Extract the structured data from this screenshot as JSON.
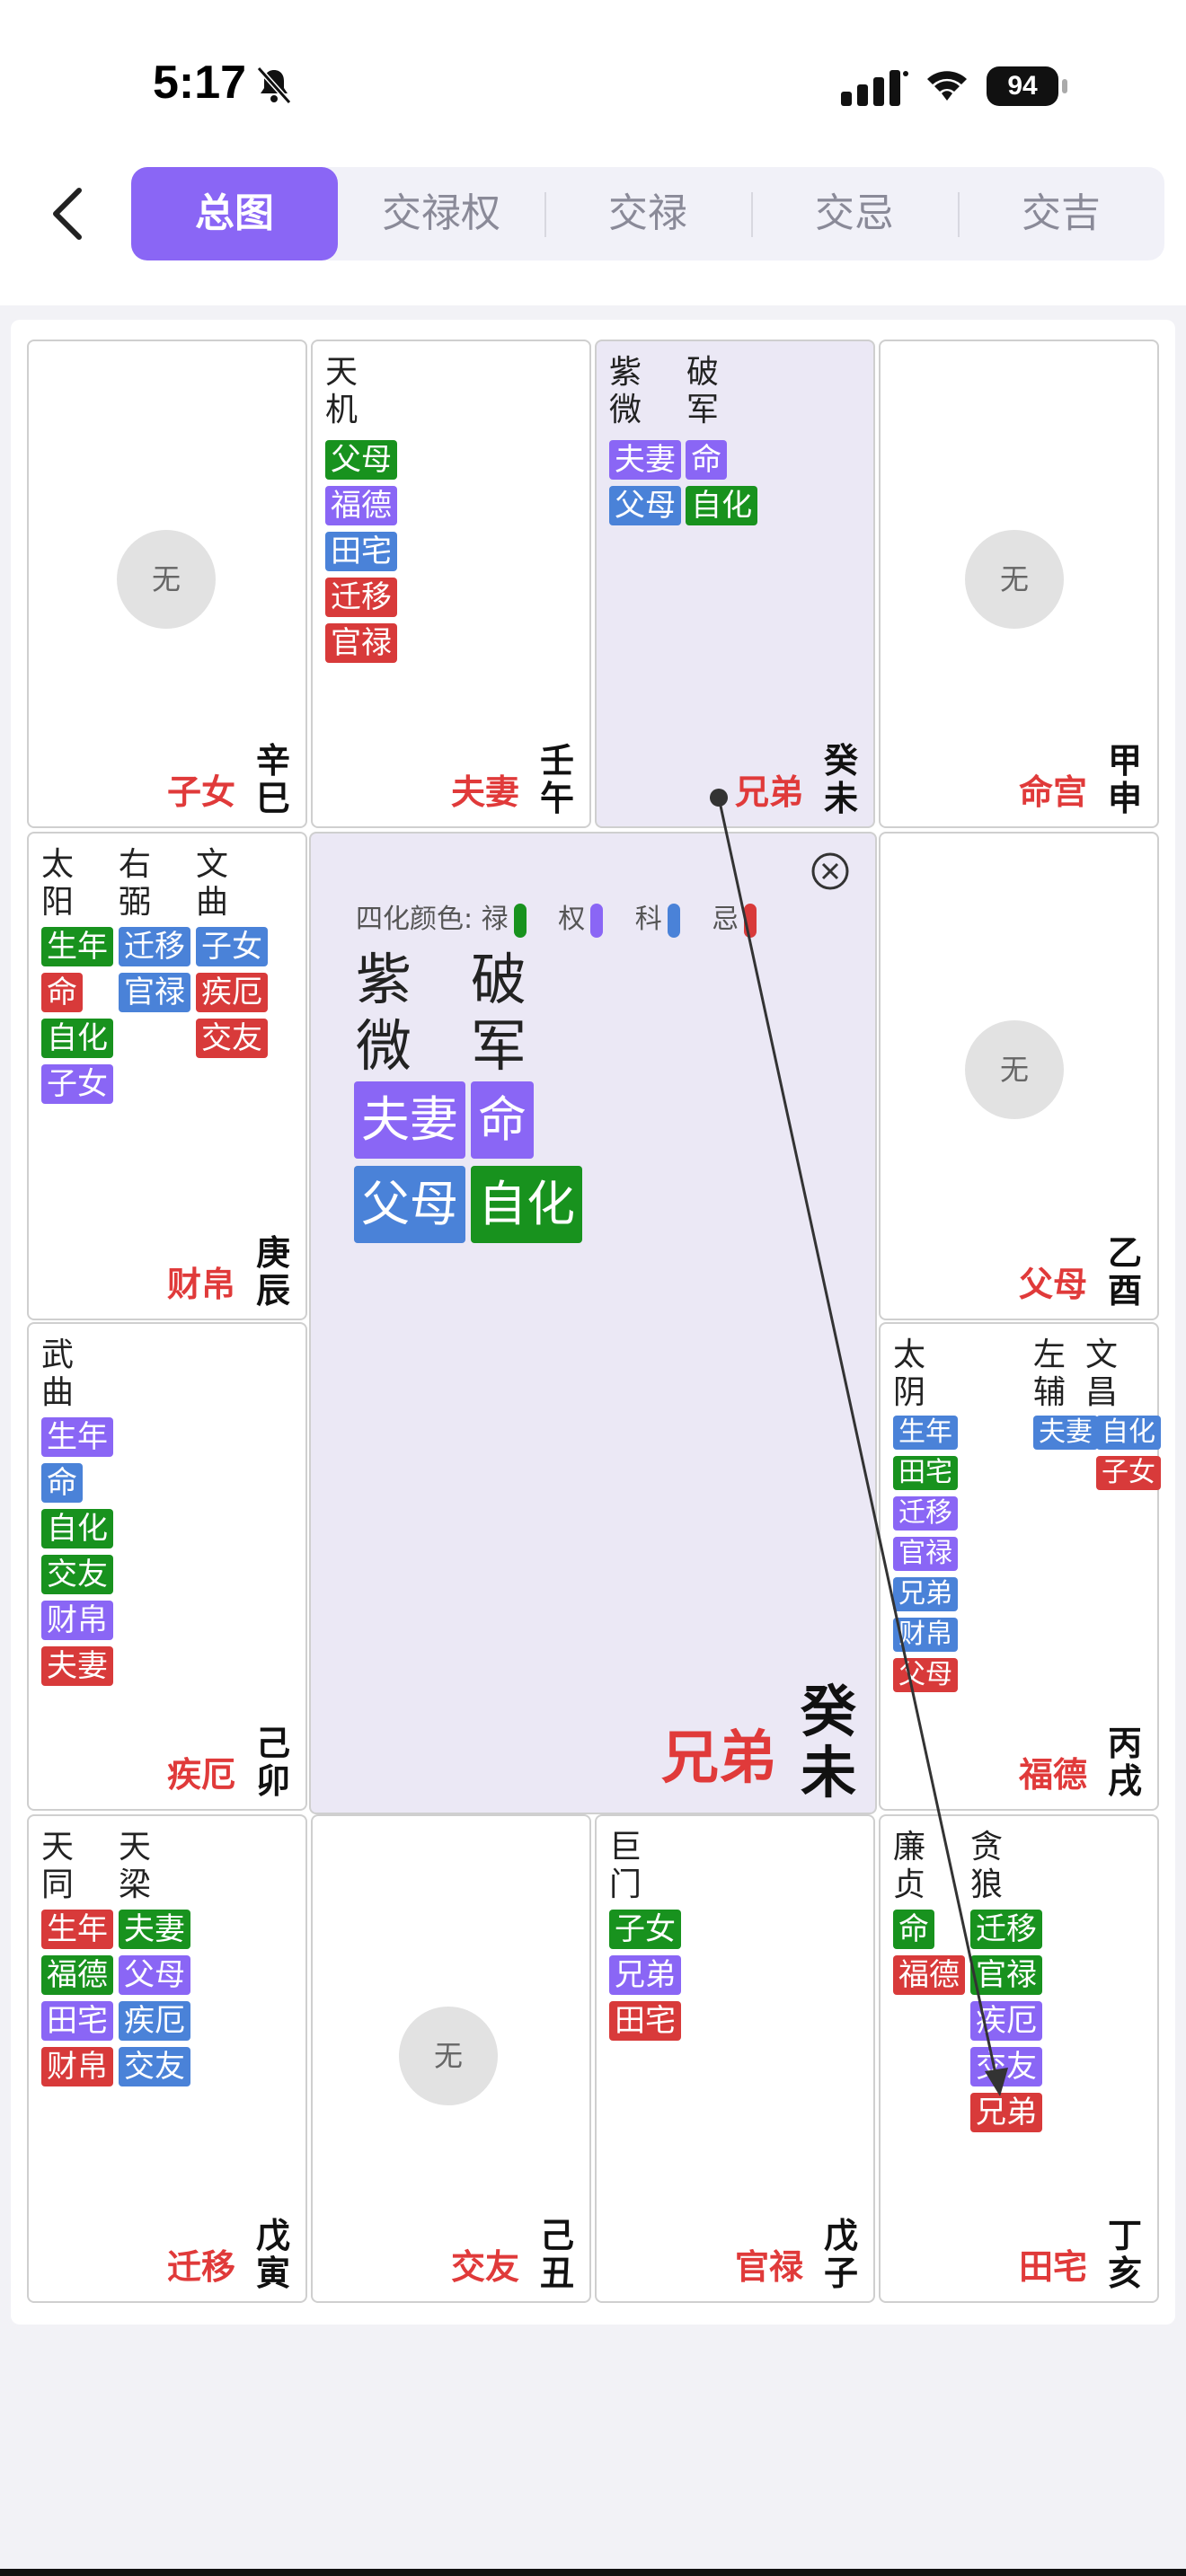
{
  "status": {
    "time": "5:17",
    "battery": "94"
  },
  "tabs": [
    "总图",
    "交禄权",
    "交禄",
    "交忌",
    "交吉"
  ],
  "legend": {
    "label": "四化颜色:",
    "items": [
      "禄",
      "权",
      "科",
      "忌"
    ]
  },
  "empty_text": "无",
  "colors": {
    "lu": "#18921e",
    "quan": "#8a66f5",
    "ke": "#4a82d8",
    "ji": "#d83a3a"
  },
  "palaces": {
    "si": {
      "name": "子女",
      "gz1": "辛",
      "gz2": "巳"
    },
    "wu": {
      "name": "夫妻",
      "gz1": "壬",
      "gz2": "午",
      "s1": [
        "天",
        "机"
      ],
      "badges": [
        "父母",
        "福德",
        "田宅",
        "迁移",
        "官禄"
      ]
    },
    "wei": {
      "name": "兄弟",
      "gz1": "癸",
      "gz2": "未",
      "s1": [
        "紫",
        "微"
      ],
      "s2": [
        "破",
        "军"
      ],
      "r1": [
        "夫妻",
        "命"
      ],
      "r2": [
        "父母",
        "自化"
      ]
    },
    "shen": {
      "name": "命宫",
      "gz1": "甲",
      "gz2": "申"
    },
    "chen": {
      "name": "财帛",
      "gz1": "庚",
      "gz2": "辰",
      "s1": [
        "太",
        "阳"
      ],
      "s2": [
        "右",
        "弼"
      ],
      "s3": [
        "文",
        "曲"
      ],
      "c1": [
        "生年",
        "命",
        "自化",
        "子女"
      ],
      "c2": [
        "迁移",
        "官禄"
      ],
      "c3": [
        "子女",
        "疾厄",
        "交友"
      ]
    },
    "you": {
      "name": "父母",
      "gz1": "乙",
      "gz2": "酉"
    },
    "mao": {
      "name": "疾厄",
      "gz1": "己",
      "gz2": "卯",
      "s1": [
        "武",
        "曲"
      ],
      "badges": [
        "生年",
        "命",
        "自化",
        "交友",
        "财帛",
        "夫妻"
      ]
    },
    "xu": {
      "name": "福德",
      "gz1": "丙",
      "gz2": "戌",
      "s1": [
        "太",
        "阴"
      ],
      "s2": [
        "左",
        "辅"
      ],
      "s3": [
        "文",
        "昌"
      ],
      "c1": [
        "生年",
        "田宅",
        "迁移",
        "官禄",
        "兄弟",
        "财帛",
        "父母"
      ],
      "c2": [
        "夫妻"
      ],
      "c3": [
        "自化",
        "子女"
      ]
    },
    "yin": {
      "name": "迁移",
      "gz1": "戊",
      "gz2": "寅",
      "s1": [
        "天",
        "同"
      ],
      "s2": [
        "天",
        "梁"
      ],
      "c1": [
        "生年",
        "福德",
        "田宅",
        "财帛"
      ],
      "c2": [
        "夫妻",
        "父母",
        "疾厄",
        "交友"
      ]
    },
    "chou": {
      "name": "交友",
      "gz1": "己",
      "gz2": "丑"
    },
    "zi": {
      "name": "官禄",
      "gz1": "戊",
      "gz2": "子",
      "s1": [
        "巨",
        "门"
      ],
      "badges": [
        "子女",
        "兄弟",
        "田宅"
      ]
    },
    "hai": {
      "name": "田宅",
      "gz1": "丁",
      "gz2": "亥",
      "s1": [
        "廉",
        "贞"
      ],
      "s2": [
        "贪",
        "狼"
      ],
      "c1": [
        "命",
        "福德"
      ],
      "c2": [
        "迁移",
        "官禄",
        "疾厄",
        "交友",
        "兄弟"
      ]
    }
  },
  "center": {
    "s1": [
      "紫",
      "微"
    ],
    "s2": [
      "破",
      "军"
    ],
    "r1": [
      "夫妻",
      "命"
    ],
    "r2": [
      "父母",
      "自化"
    ],
    "palace": "兄弟",
    "gz1": "癸",
    "gz2": "未"
  }
}
